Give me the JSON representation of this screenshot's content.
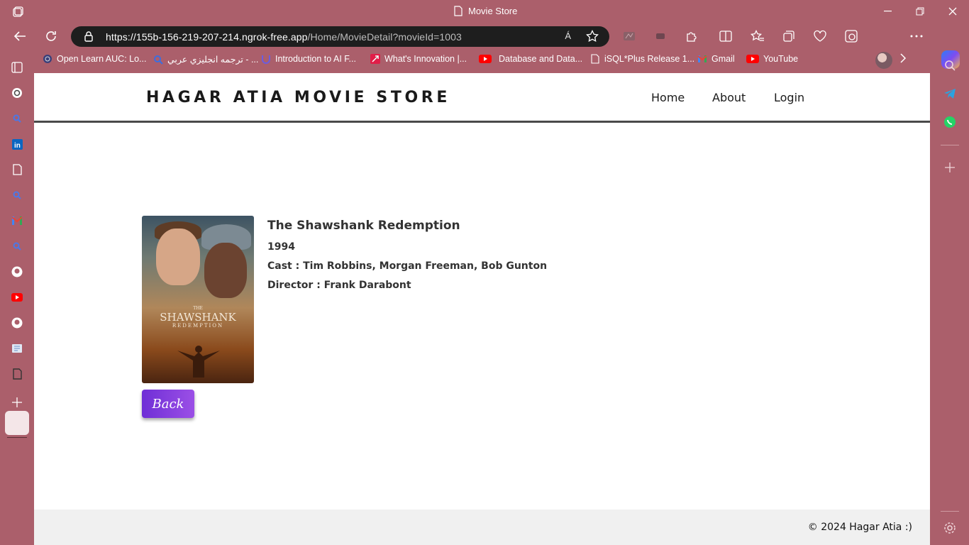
{
  "browser": {
    "tab_title": "Movie Store",
    "url_host": "https://155b-156-219-207-214.ngrok-free.app",
    "url_path": "/Home/MovieDetail?movieId=1003",
    "read_aloud": "Á",
    "bookmarks": [
      {
        "label": "Open Learn AUC: Lo...",
        "icon": "openlearn-icon"
      },
      {
        "label": "ترجمه انجليزي عربي - ...",
        "icon": "search-icon"
      },
      {
        "label": "Introduction to AI F...",
        "icon": "udacity-icon"
      },
      {
        "label": "What's Innovation |...",
        "icon": "rocket-icon"
      },
      {
        "label": "Database and Data...",
        "icon": "youtube-icon"
      },
      {
        "label": "iSQL*Plus Release 1...",
        "icon": "page-icon"
      },
      {
        "label": "Gmail",
        "icon": "google-icon"
      },
      {
        "label": "YouTube",
        "icon": "youtube-icon"
      }
    ],
    "colors": {
      "frame": "#ab5f6b",
      "urlbar": "#1e1e1e",
      "youtube": "#ff0000",
      "linkedin": "#0a66c2",
      "whatsapp": "#25d366",
      "telegram": "#2aa3e0"
    }
  },
  "site": {
    "brand": "HAGAR ATIA MOVIE STORE",
    "nav": {
      "home": "Home",
      "about": "About",
      "login": "Login"
    },
    "movie": {
      "title": "The Shawshank Redemption",
      "year": "1994",
      "cast": "Cast : Tim Robbins, Morgan Freeman, Bob Gunton",
      "director": "Director : Frank Darabont",
      "poster_small": "THE",
      "poster_title": "SHAWSHANK",
      "poster_sub": "REDEMPTION"
    },
    "back_label": "Back",
    "footer": "© 2024 Hagar Atia :)",
    "colors": {
      "button_start": "#6f2fd6",
      "button_end": "#9b4fe6",
      "header_border": "#4a4a4a",
      "footer_bg": "#f0f0f0"
    }
  }
}
